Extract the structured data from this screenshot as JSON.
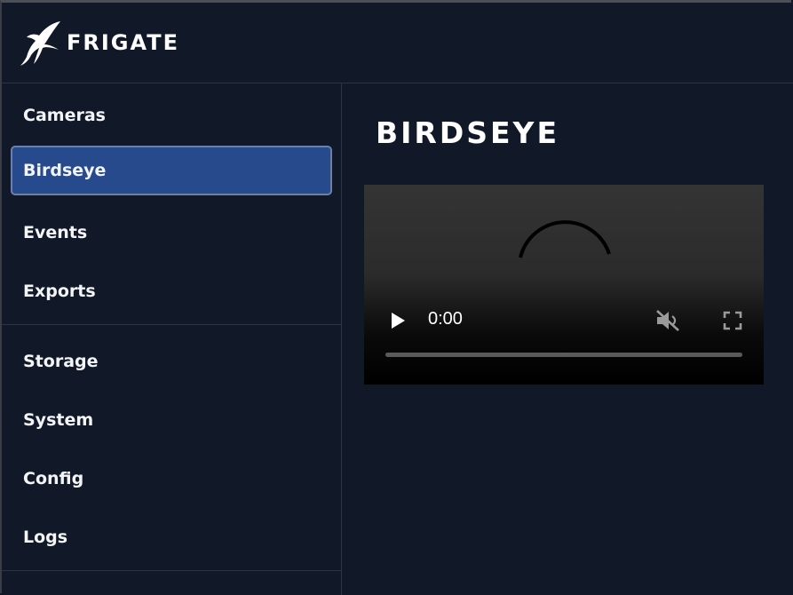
{
  "app": {
    "brand": "FRIGATE"
  },
  "sidebar": {
    "items": [
      {
        "label": "Cameras",
        "active": false
      },
      {
        "label": "Birdseye",
        "active": true
      },
      {
        "label": "Events",
        "active": false
      },
      {
        "label": "Exports",
        "active": false
      },
      {
        "label": "Storage",
        "active": false
      },
      {
        "label": "System",
        "active": false
      },
      {
        "label": "Config",
        "active": false
      },
      {
        "label": "Logs",
        "active": false
      }
    ]
  },
  "main": {
    "title": "BIRDSEYE",
    "video": {
      "time": "0:00",
      "progress": 0,
      "muted": true,
      "loading": true
    }
  },
  "colors": {
    "background": "#111827",
    "active_item": "#264a8c",
    "active_border": "#6b7fa8",
    "divider": "#2e3440"
  },
  "icons": [
    "frigate-bird-logo-icon",
    "play-icon",
    "muted-speaker-icon",
    "fullscreen-icon",
    "loading-spinner-icon"
  ]
}
